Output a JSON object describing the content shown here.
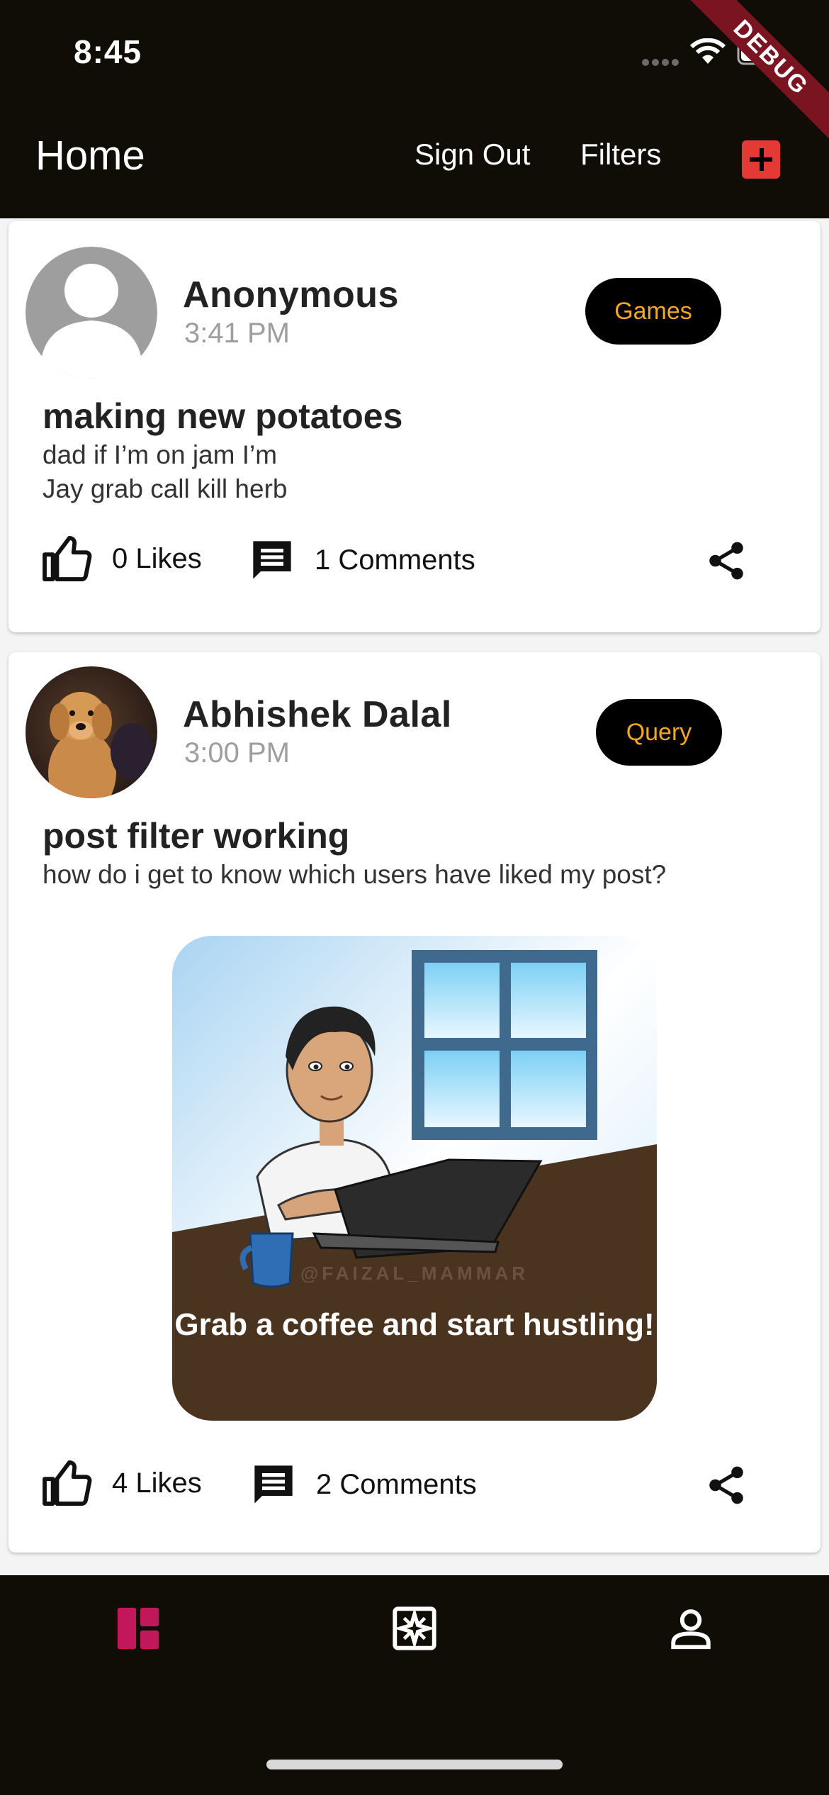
{
  "status_bar": {
    "time": "8:45",
    "debug_label": "DEBUG"
  },
  "app_bar": {
    "title": "Home",
    "sign_out_label": "Sign Out",
    "filters_label": "Filters",
    "add_icon": "plus-icon",
    "add_color": "#e53935"
  },
  "posts": [
    {
      "author": "Anonymous",
      "time": "3:41 PM",
      "tag": "Games",
      "title": "making new potatoes",
      "body": "dad if I’m on jam I’m\nJay grab call kill herb",
      "likes_label": "0 Likes",
      "comments_label": "1 Comments"
    },
    {
      "author": "Abhishek Dalal",
      "time": "3:00 PM",
      "tag": "Query",
      "title": "post filter working",
      "body": "how do i get to know which users have liked my post?",
      "image_caption": "Grab a coffee and start hustling!",
      "image_watermark": "@FAIZAL_MAMMAR",
      "likes_label": "4 Likes",
      "comments_label": "2 Comments"
    }
  ],
  "bottom_nav": {
    "items": [
      "dashboard-icon",
      "explore-icon",
      "person-icon"
    ],
    "active_color": "#c2185b"
  },
  "colors": {
    "bar_bg": "#0f0d06",
    "tag_text": "#f5a623"
  }
}
